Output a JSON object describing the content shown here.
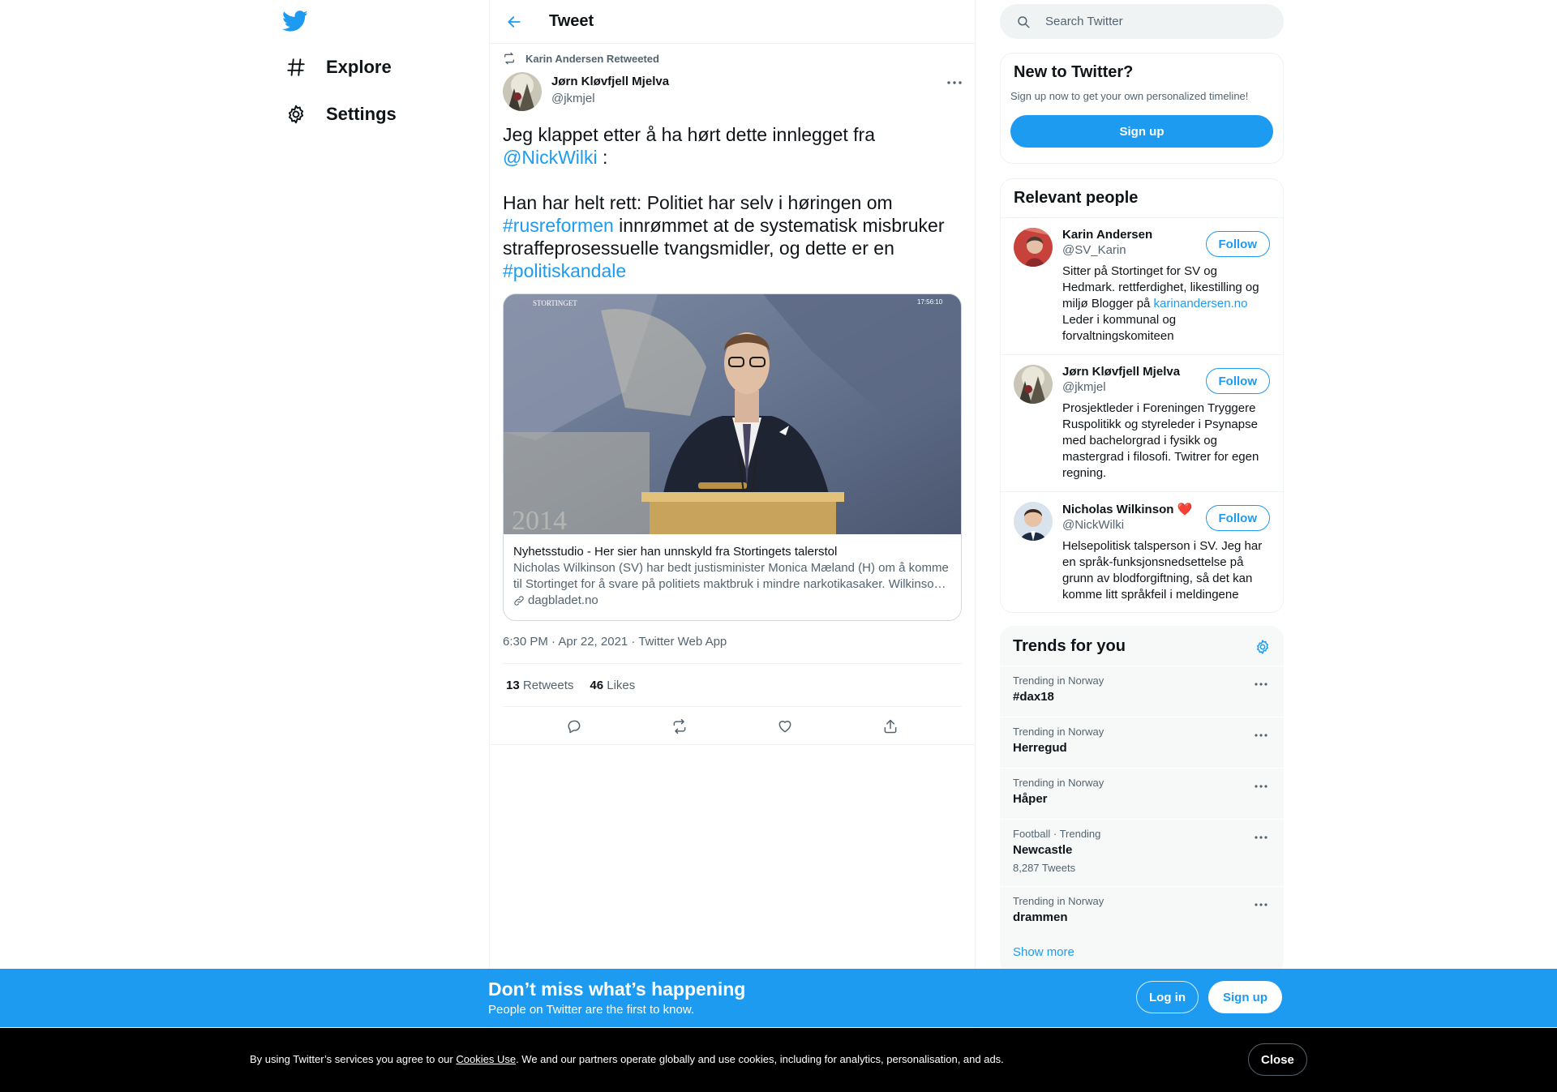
{
  "nav": {
    "items": [
      {
        "label": "Explore",
        "icon": "hashtag-icon"
      },
      {
        "label": "Settings",
        "icon": "gear-icon"
      }
    ]
  },
  "header": {
    "title": "Tweet"
  },
  "tweet": {
    "retweeted_by": "Karin Andersen Retweeted",
    "author_name": "Jørn Kløvfjell Mjelva",
    "author_handle": "@jkmjel",
    "text": {
      "p1_a": "Jeg klappet etter å ha hørt dette innlegget fra",
      "mention": "@NickWilki",
      "p1_b": " :",
      "p2_a": "Han har helt rett: Politiet har selv i høringen om ",
      "hashtag1": "#rusreformen",
      "p2_b": " innrømmet at de systematisk misbruker straffeprosessuelle tvangsmidler, og dette er en ",
      "hashtag2": "#politiskandale"
    },
    "card": {
      "image_caption": "STORTINGET",
      "image_time": "17:56:10",
      "title": "Nyhetsstudio - Her sier han unnskyld fra Stortingets talerstol",
      "description": "Nicholas Wilkinson (SV) har bedt justisminister Monica Mæland (H) om å komme til Stortinget for å svare på politiets maktbruk i mindre narkotikasaker. Wilkinson mener det er for mye \"hverdagsvold\" fra politiet.",
      "domain": "dagbladet.no"
    },
    "meta": "6:30 PM · Apr 22, 2021 · Twitter Web App",
    "retweets_count": "13",
    "retweets_label": "Retweets",
    "likes_count": "46",
    "likes_label": "Likes"
  },
  "search": {
    "placeholder": "Search Twitter"
  },
  "new_to_twitter": {
    "title": "New to Twitter?",
    "subtitle": "Sign up now to get your own personalized timeline!",
    "button": "Sign up"
  },
  "relevant_people": {
    "title": "Relevant people",
    "people": [
      {
        "name": "Karin Andersen",
        "handle": "@SV_Karin",
        "bio_a": "Sitter på Stortinget for SV og Hedmark. rettferdighet, likestilling og miljø Blogger på ",
        "bio_link": "karinandersen.no",
        "bio_b": " Leder i kommunal og forvaltningskomiteen",
        "follow": "Follow"
      },
      {
        "name": "Jørn Kløvfjell Mjelva",
        "handle": "@jkmjel",
        "bio_a": "Prosjektleder i Foreningen Tryggere Ruspolitikk og styreleder i Psynapse med bachelorgrad i fysikk og mastergrad i filosofi. Twitrer for egen regning.",
        "bio_link": "",
        "bio_b": "",
        "follow": "Follow"
      },
      {
        "name": "Nicholas Wilkinson",
        "name_emoji": "❤️",
        "handle": "@NickWilki",
        "bio_a": "Helsepolitisk talsperson i SV. Jeg har en språk-funksjonsnedsettelse på grunn av blodforgiftning, så det kan komme litt språkfeil i meldingene",
        "bio_link": "",
        "bio_b": "",
        "follow": "Follow"
      }
    ]
  },
  "trends": {
    "title": "Trends for you",
    "items": [
      {
        "context": "Trending in Norway",
        "name": "#dax18",
        "count": ""
      },
      {
        "context": "Trending in Norway",
        "name": "Herregud",
        "count": ""
      },
      {
        "context": "Trending in Norway",
        "name": "Håper",
        "count": ""
      },
      {
        "context": "Football · Trending",
        "name": "Newcastle",
        "count": "8,287 Tweets"
      },
      {
        "context": "Trending in Norway",
        "name": "drammen",
        "count": ""
      }
    ],
    "show_more": "Show more"
  },
  "bottom_bar": {
    "title": "Don’t miss what’s happening",
    "subtitle": "People on Twitter are the first to know.",
    "login": "Log in",
    "signup": "Sign up"
  },
  "cookie": {
    "text_a": "By using Twitter’s services you agree to our ",
    "link": "Cookies Use",
    "text_b": ". We and our partners operate globally and use cookies, including for analytics, personalisation, and ads.",
    "close": "Close"
  },
  "colors": {
    "accent": "#1d9bf0",
    "text": "#0f1419",
    "muted": "#536471",
    "border": "#eff3f4"
  }
}
